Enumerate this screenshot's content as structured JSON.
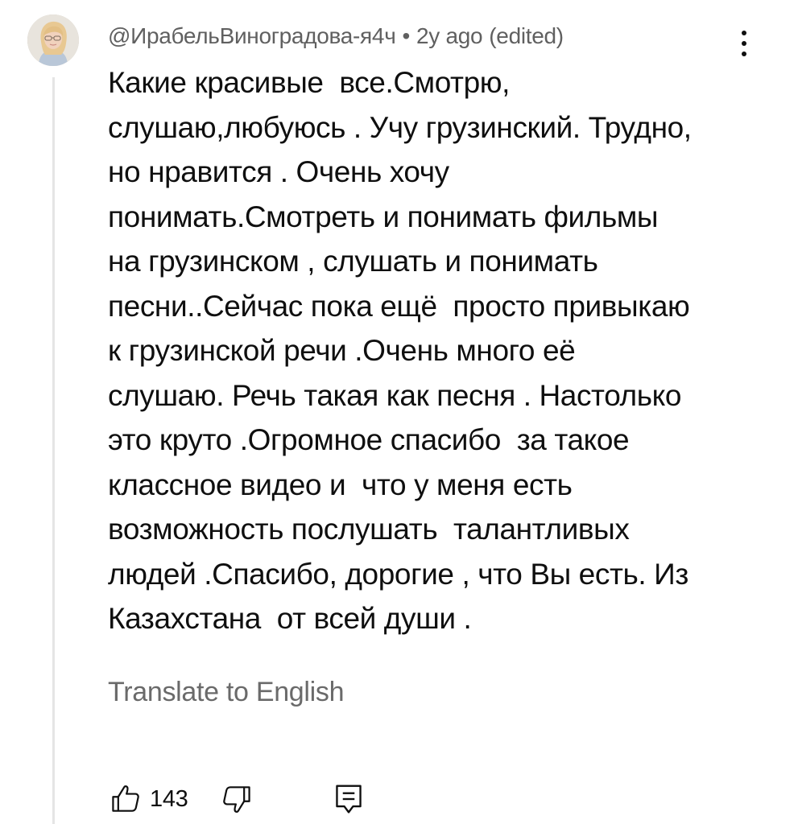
{
  "comment": {
    "author": "@ИрабельВиноградова-я4ч",
    "separator": "•",
    "timestamp": "2y ago",
    "edited": "(edited)",
    "text": "Какие красивые  все.Смотрю,\nслушаю,любуюсь . Учу грузинский. Трудно,\nно нравится . Очень хочу\nпонимать.Смотреть и понимать фильмы\nна грузинском , слушать и понимать\nпесни..Сейчас пока ещё  просто привыкаю\nк грузинской речи .Очень много её\nслушаю. Речь такая как песня . Настолько\nэто круто .Огромное спасибо  за такое\nклассное видео и  что у меня есть\nвозможность послушать  талантливых\nлюдей .Спасибо, дорогие , что Вы есть. Из\nКазахстана  от всей души .",
    "translate_label": "Translate to English",
    "like_count": "143"
  },
  "icons": {
    "avatar": "avatar-photo",
    "more": "more-vertical-icon",
    "like": "thumbs-up-icon",
    "dislike": "thumbs-down-icon",
    "reply": "reply-comment-icon"
  },
  "colors": {
    "primary_text": "#0f0f0f",
    "secondary_text": "#606060",
    "link_text": "#6a6a6a",
    "thread_line": "#e5e5e5",
    "background": "#ffffff"
  }
}
